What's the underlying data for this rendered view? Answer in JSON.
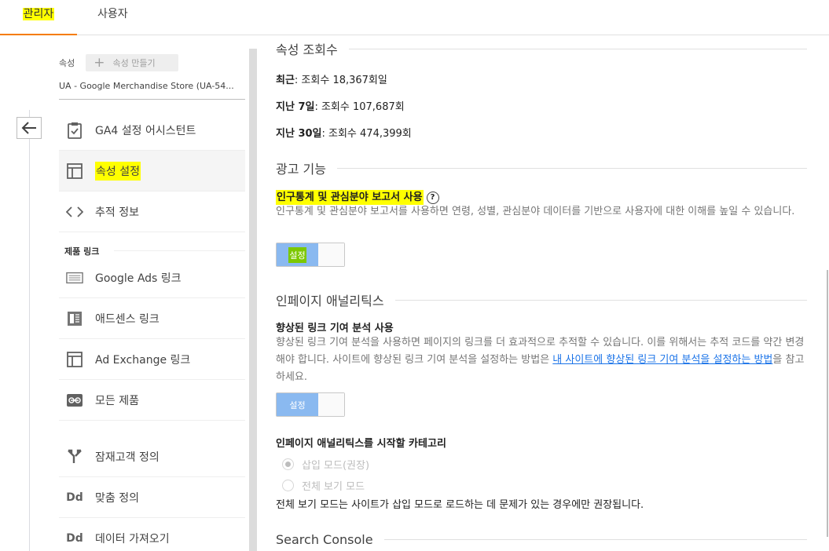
{
  "tabs": {
    "admin": "관리자",
    "user": "사용자"
  },
  "sidebar": {
    "property_label": "속성",
    "create_property": "속성 만들기",
    "property_select": "UA - Google Merchandise Store (UA-54...",
    "items": [
      {
        "label": "GA4 설정 어시스턴트",
        "icon": "clipboard-check-icon"
      },
      {
        "label": "속성 설정",
        "icon": "layout-icon"
      },
      {
        "label": "추적 정보",
        "icon": "code-icon"
      }
    ],
    "product_links_heading": "제품 링크",
    "product_links": [
      {
        "label": "Google Ads 링크",
        "icon": "ads-icon"
      },
      {
        "label": "애드센스 링크",
        "icon": "adsense-icon"
      },
      {
        "label": "Ad Exchange 링크",
        "icon": "adexchange-icon"
      },
      {
        "label": "모든 제품",
        "icon": "link-icon"
      }
    ],
    "other_items": [
      {
        "label": "잠재고객 정의",
        "icon": "fork-icon"
      },
      {
        "label": "맞춤 정의",
        "icon": "dd-icon"
      },
      {
        "label": "데이터 가져오기",
        "icon": "dd-icon"
      }
    ]
  },
  "main": {
    "views_title": "속성 조회수",
    "stats": [
      {
        "label": "최근",
        "value": ": 조회수 18,367회일"
      },
      {
        "label": "지난 7일",
        "value": ": 조회수 107,687회"
      },
      {
        "label": "지난 30일",
        "value": ": 조회수 474,399회"
      }
    ],
    "ads_title": "광고 기능",
    "demographics_label": "인구통계 및 관심분야 보고서 사용",
    "demographics_desc": "인구통계 및 관심분야 보고서를 사용하면 연령, 성별, 관심분야 데이터를 기반으로 사용자에 대한 이해를 높일 수 있습니다.",
    "toggle_on": "설정",
    "inpage_title": "인페이지 애널리틱스",
    "enhanced_label": "향상된 링크 기여 분석 사용",
    "enhanced_desc": "향상된 링크 기여 분석을 사용하면 페이지의 링크를 더 효과적으로 추적할 수 있습니다. 이를 위해서는 추적 코드를 약간 변경해야 합니다. 사이트에 향상된 링크 기여 분석을 설정하는 방법은 ",
    "enhanced_link": "내 사이트에 향상된 링크 기여 분석을 설정하는 방법",
    "enhanced_suffix": "을 참고하세요.",
    "start_category_label": "인페이지 애널리틱스를 시작할 카테고리",
    "radio_embed": "삽입 모드(권장)",
    "radio_full": "전체 보기 모드",
    "full_view_note": "전체 보기 모드는 사이트가 삽입 모드로 로드하는 데 문제가 있는 경우에만 권장됩니다.",
    "search_console_title": "Search Console"
  },
  "colors": {
    "highlight": "#ffff00",
    "accent": "#f57c00",
    "toggle": "#8ab9f0",
    "link": "#1a73e8"
  }
}
